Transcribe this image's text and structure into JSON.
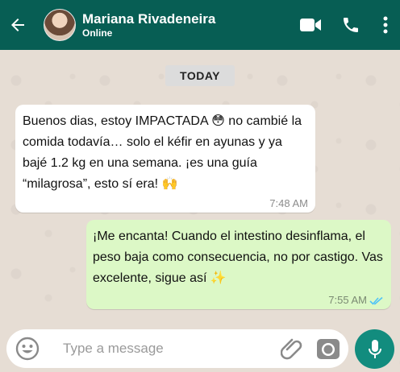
{
  "header": {
    "contact_name": "Mariana Rivadeneira",
    "status": "Online",
    "icons": [
      "back-arrow-icon",
      "video-call-icon",
      "phone-icon",
      "more-options-icon"
    ]
  },
  "chat": {
    "date_label": "TODAY",
    "messages": [
      {
        "direction": "incoming",
        "text": "Buenos dias, estoy IMPACTADA 😳 no cambié la comida todavía… solo el kéfir en ayunas y ya bajé 1.2 kg en una semana. ¡es una guía “milagrosa”, esto sí era! 🙌",
        "time": "7:48 AM"
      },
      {
        "direction": "outgoing",
        "text": "¡Me encanta! Cuando el intestino desinflama, el peso baja como consecuencia, no por castigo. Vas excelente, sigue así ✨",
        "time": "7:55 AM",
        "status": "read"
      }
    ]
  },
  "composer": {
    "placeholder": "Type a message"
  },
  "colors": {
    "header": "#075e54",
    "outgoing_bubble": "#dcf8c6",
    "mic_button": "#128c7e",
    "read_ticks": "#4fc3f7"
  }
}
